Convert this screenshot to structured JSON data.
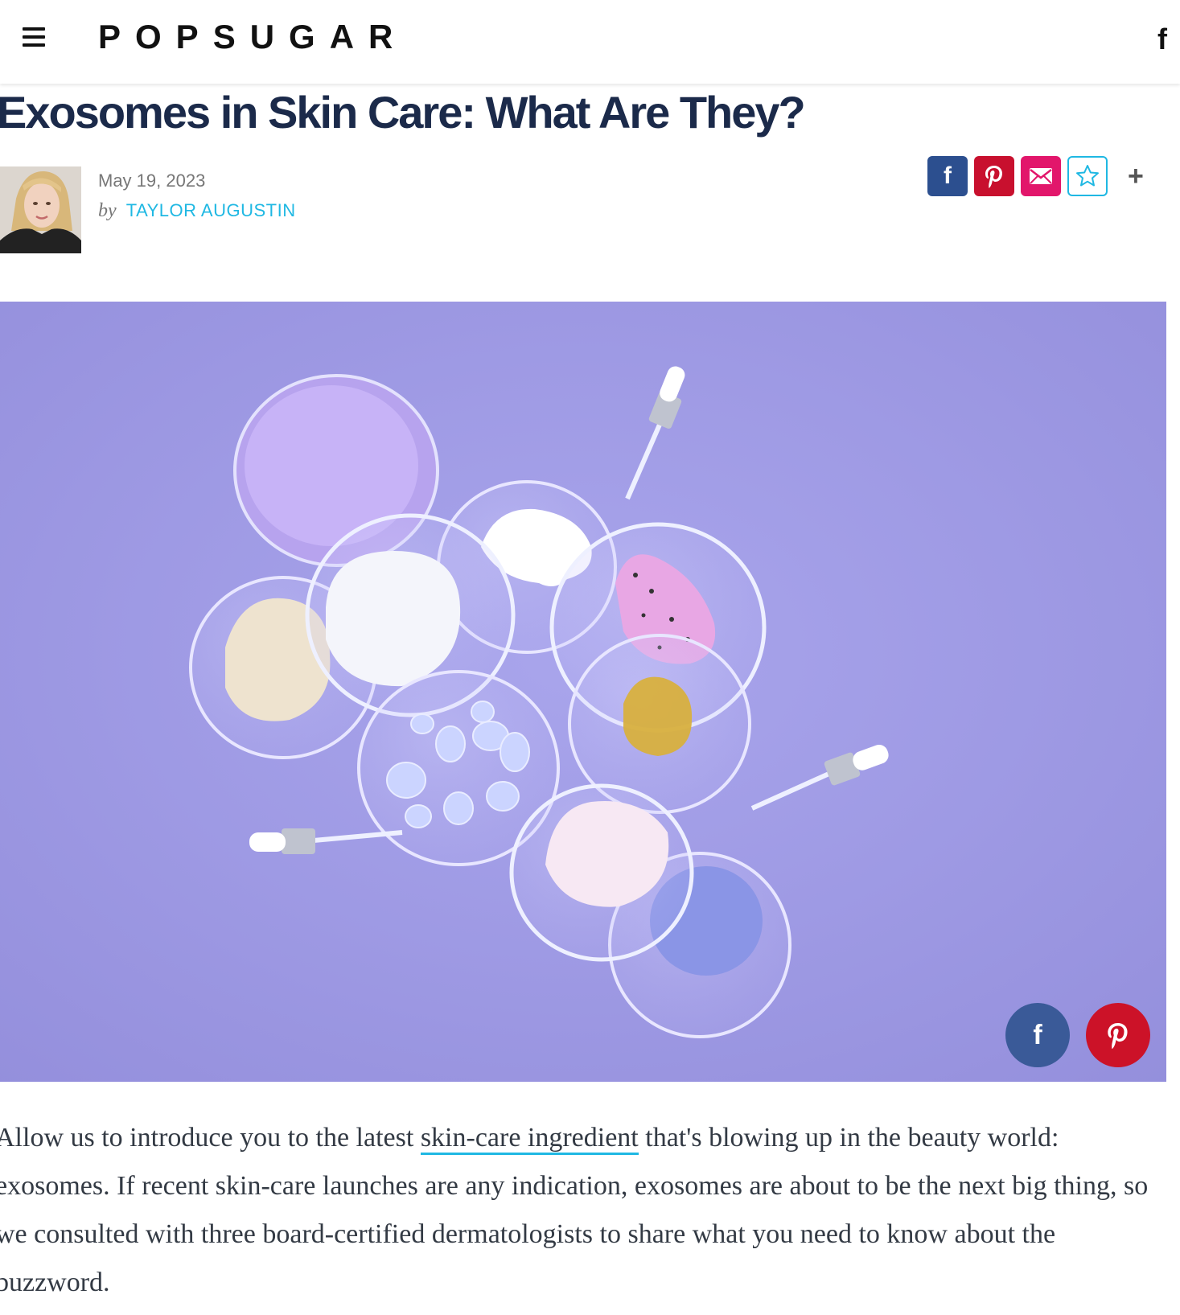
{
  "header": {
    "logo": "POPSUGAR",
    "facebook_icon_glyph": "f"
  },
  "article": {
    "title": "Exosomes in Skin Care: What Are They?",
    "date": "May 19, 2023",
    "by": "by",
    "author": "TAYLOR AUGUSTIN",
    "body": {
      "before_link": "Allow us to introduce you to the latest ",
      "link_text": "skin-care ingredient",
      "after_link": " that's blowing up in the beauty world: exosomes. If recent skin-care launches are any indication, exosomes are about to be the next big thing, so we consulted with three board-certified dermatologists to share what you need to know about the buzzword."
    }
  },
  "share": {
    "buttons": [
      "facebook-icon",
      "pinterest-icon",
      "mail-icon",
      "star-icon"
    ],
    "more": "+"
  },
  "hero_image": {
    "subject": "petri dishes with skin-care textures on lavender background",
    "share_buttons": [
      "facebook-icon",
      "pinterest-icon"
    ]
  },
  "colors": {
    "title": "#1b2a4a",
    "accent": "#1fb8e3",
    "facebook": "#2c4f8f",
    "pinterest": "#c8102e",
    "mail": "#e2166b",
    "hero_bg": "#9f9be5"
  }
}
